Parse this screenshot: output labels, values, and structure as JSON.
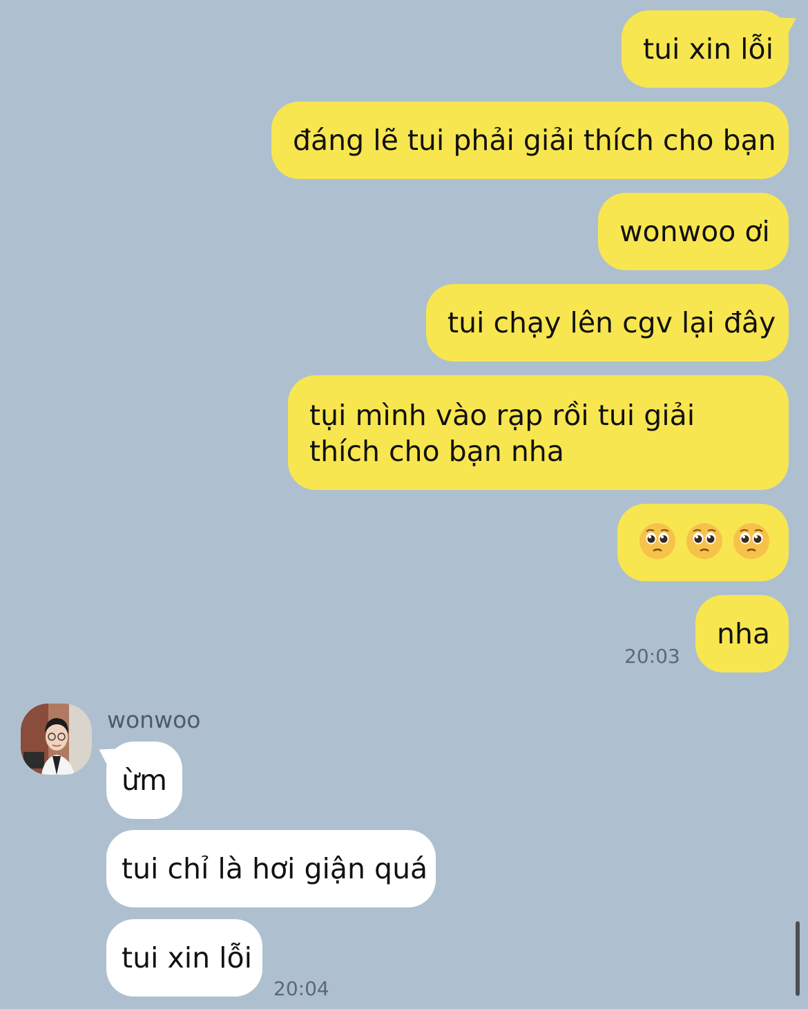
{
  "outgoing_messages": [
    {
      "text": "tui xin lỗi"
    },
    {
      "text": "đáng lẽ tui phải giải thích cho bạn"
    },
    {
      "text": "wonwoo ơi"
    },
    {
      "text": "tui chạy lên cgv lại đây"
    },
    {
      "text": "tụi mình vào rạp rồi tui giải thích cho bạn nha"
    },
    {
      "text": "🥺🥺🥺",
      "icon": "pleading-face-icon"
    },
    {
      "text": "nha"
    }
  ],
  "outgoing_time": "20:03",
  "incoming": {
    "sender_name": "wonwoo",
    "messages": [
      {
        "text": "ừm"
      },
      {
        "text": "tui chỉ là hơi giận quá"
      },
      {
        "text": "tui xin lỗi"
      }
    ],
    "time": "20:04"
  },
  "colors": {
    "background": "#aec0cf",
    "outgoing_bubble": "#f8e650",
    "incoming_bubble": "#ffffff"
  }
}
